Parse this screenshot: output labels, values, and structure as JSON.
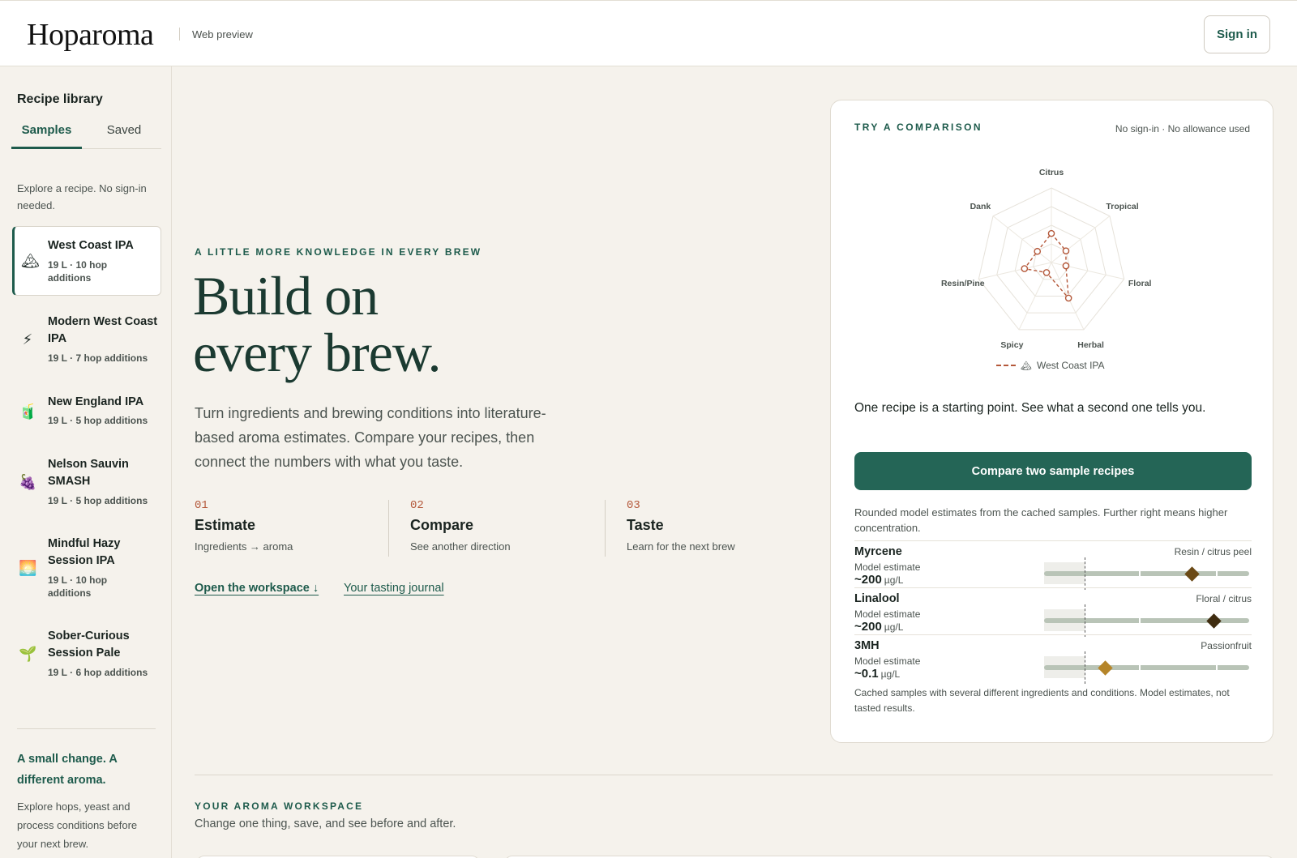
{
  "header": {
    "logo": "Hoparoma",
    "subtitle": "Web preview",
    "signin_label": "Sign in"
  },
  "sidebar": {
    "title": "Recipe library",
    "tabs": [
      "Samples",
      "Saved"
    ],
    "active_tab": "Samples",
    "intro": "Explore a recipe. No sign-in needed.",
    "recipes": [
      {
        "icon": "mountain-icon",
        "glyph": "🏔",
        "name": "West Coast IPA",
        "meta": "19 L · 10 hop additions",
        "active": true
      },
      {
        "icon": "lightning-icon",
        "glyph": "⚡",
        "name": "Modern West Coast IPA",
        "meta": "19 L · 7 hop additions",
        "active": false
      },
      {
        "icon": "juice-box-icon",
        "glyph": "🧃",
        "name": "New England IPA",
        "meta": "19 L · 5 hop additions",
        "active": false
      },
      {
        "icon": "grapes-icon",
        "glyph": "🍇",
        "name": "Nelson Sauvin SMASH",
        "meta": "19 L · 5 hop additions",
        "active": false
      },
      {
        "icon": "sunset-icon",
        "glyph": "🌅",
        "name": "Mindful Hazy Session IPA",
        "meta": "19 L · 10 hop additions",
        "active": false
      },
      {
        "icon": "seedling-icon",
        "glyph": "🌱",
        "name": "Sober-Curious Session Pale",
        "meta": "19 L · 6 hop additions",
        "active": false
      }
    ],
    "promo_title": "A small change. A different aroma.",
    "promo_text": "Explore hops, yeast and process conditions before your next brew."
  },
  "hero": {
    "eyebrow": "A LITTLE MORE KNOWLEDGE IN EVERY BREW",
    "title_line1": "Build on",
    "title_line2": "every brew.",
    "description": "Turn ingredients and brewing conditions into literature-based aroma estimates. Compare your recipes, then connect the numbers with what you taste.",
    "steps": [
      {
        "num": "01",
        "title": "Estimate",
        "sub": "Ingredients → aroma"
      },
      {
        "num": "02",
        "title": "Compare",
        "sub": "See another direction"
      },
      {
        "num": "03",
        "title": "Taste",
        "sub": "Learn for the next brew"
      }
    ],
    "primary_link": "Open the workspace ↓",
    "secondary_link": "Your tasting journal"
  },
  "card": {
    "eyebrow": "TRY A COMPARISON",
    "note": "No sign-in · No allowance used",
    "lead": "One recipe is a starting point. See what a second one tells you.",
    "cta_label": "Compare two sample recipes",
    "description": "Rounded model estimates from the cached samples. Further right means higher concentration.",
    "compounds": [
      {
        "name": "Myrcene",
        "tag": "Resin / citrus peel",
        "label": "Model estimate",
        "value": "~200",
        "unit": "µg/L",
        "position": 0.72,
        "color": "#6b4a16"
      },
      {
        "name": "Linalool",
        "tag": "Floral / citrus",
        "label": "Model estimate",
        "value": "~200",
        "unit": "µg/L",
        "position": 0.83,
        "color": "#3f2c10"
      },
      {
        "name": "3MH",
        "tag": "Passionfruit",
        "label": "Model estimate",
        "value": "~0.1",
        "unit": "µg/L",
        "position": 0.3,
        "color": "#b58529"
      }
    ],
    "footer": "Cached samples with several different ingredients and conditions. Model estimates, not tasted results."
  },
  "chart_data": {
    "type": "radar",
    "axes": [
      "Citrus",
      "Tropical",
      "Floral",
      "Herbal",
      "Spicy",
      "Resin/Pine",
      "Dank"
    ],
    "series": [
      {
        "name": "West Coast IPA",
        "values": [
          0.39,
          0.25,
          0.2,
          0.53,
          0.15,
          0.37,
          0.24
        ],
        "color": "#b4583a"
      }
    ],
    "range": [
      0,
      1
    ],
    "rings": 4
  },
  "workspace": {
    "eyebrow": "YOUR AROMA WORKSPACE",
    "subtitle": "Change one thing, save, and see before and after."
  }
}
